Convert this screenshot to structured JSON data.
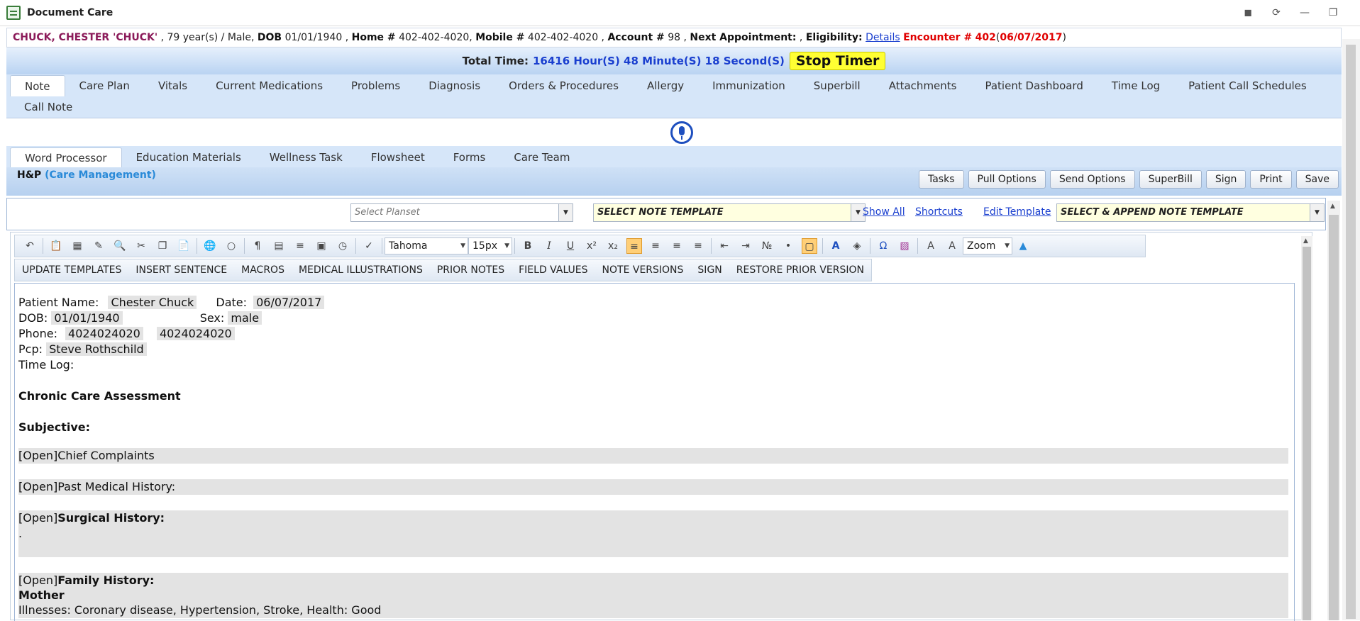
{
  "window": {
    "title": "Document Care",
    "controls": [
      "pin-icon",
      "restore-icon",
      "minimize-icon",
      "maximize-icon"
    ]
  },
  "patient": {
    "name": "CHUCK, CHESTER 'CHUCK'",
    "age_sex": ", 79 year(s) / Male,",
    "dob_label": "DOB",
    "dob": "01/01/1940 ,",
    "home_label": "Home #",
    "home": "402-402-4020,",
    "mobile_label": "Mobile #",
    "mobile": "402-402-4020 ,",
    "account_label": "Account #",
    "account": "98 ,",
    "next_appt_label": "Next Appointment:",
    "next_appt": ",",
    "eligibility_label": "Eligibility:",
    "eligibility_link": "Details",
    "encounter_label": "Encounter #",
    "encounter": "402",
    "encounter_date": "06/07/2017",
    "open_paren": "(",
    "close_paren": ")"
  },
  "timer": {
    "label": "Total Time:",
    "value": "16416 Hour(S) 48 Minute(S) 18 Second(S)",
    "button": "Stop Timer"
  },
  "main_tabs": {
    "row1": [
      "Note",
      "Care Plan",
      "Vitals",
      "Current Medications",
      "Problems",
      "Diagnosis",
      "Orders & Procedures",
      "Allergy",
      "Immunization",
      "Superbill",
      "Attachments",
      "Patient Dashboard",
      "Time Log",
      "Patient Call Schedules"
    ],
    "row2": [
      "Call Note"
    ]
  },
  "sub_tabs": [
    "Word Processor",
    "Education Materials",
    "Wellness Task",
    "Flowsheet",
    "Forms",
    "Care Team"
  ],
  "section": {
    "title": "H&P",
    "subtitle": "(Care Management)",
    "buttons": [
      "Tasks",
      "Pull Options",
      "Send Options",
      "SuperBill",
      "Sign",
      "Print",
      "Save"
    ]
  },
  "selectors": {
    "planset_placeholder": "Select Planset",
    "note_template": "SELECT NOTE TEMPLATE",
    "show_all": "Show All",
    "shortcuts": "Shortcuts",
    "edit_template": "Edit Template",
    "append_template": "SELECT & APPEND NOTE TEMPLATE"
  },
  "toolbar": {
    "font": "Tahoma",
    "size": "15px",
    "zoom": "Zoom"
  },
  "toolbar2": [
    "UPDATE TEMPLATES",
    "INSERT SENTENCE",
    "MACROS",
    "MEDICAL ILLUSTRATIONS",
    "PRIOR NOTES",
    "FIELD VALUES",
    "NOTE VERSIONS",
    "SIGN",
    "RESTORE PRIOR VERSION"
  ],
  "doc": {
    "patient_name_label": "Patient Name:",
    "patient_name": "Chester Chuck",
    "date_label": "Date:",
    "date": "06/07/2017",
    "dob_label": "DOB:",
    "dob": "01/01/1940",
    "sex_label": "Sex:",
    "sex": "male",
    "phone_label": "Phone:",
    "phone1": "4024024020",
    "phone2": "4024024020",
    "pcp_label": "Pcp:",
    "pcp": "Steve Rothschild",
    "time_log_label": "Time Log:",
    "heading": "Chronic Care Assessment",
    "subjective": "Subjective:",
    "open_tag": "[Open]",
    "chief_complaints": "Chief Complaints",
    "past_medical_history": "Past Medical History:",
    "surgical_history": "Surgical History:",
    "surgical_dot": ".",
    "family_history": "Family History:",
    "mother": "Mother",
    "illnesses": "Illnesses: Coronary disease, Hypertension, Stroke, Health: Good"
  }
}
